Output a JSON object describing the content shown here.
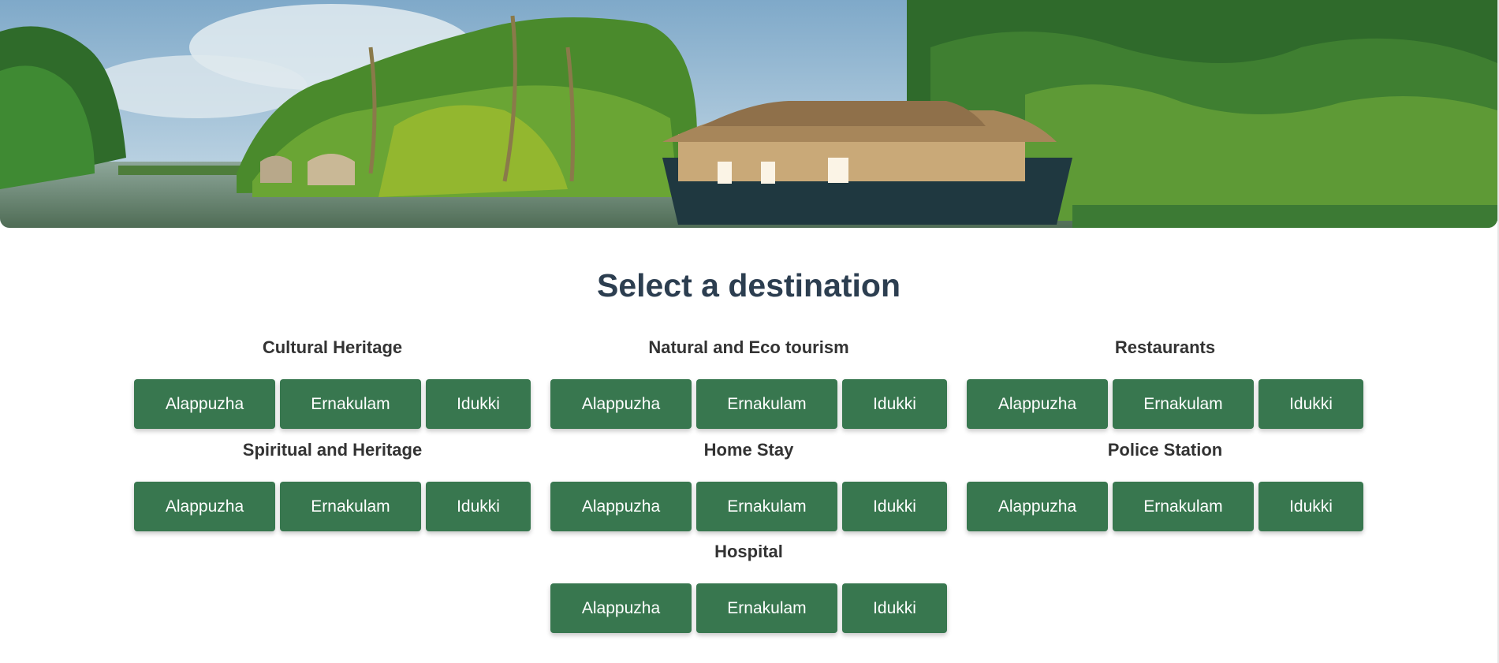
{
  "hero": {
    "alt": "Kerala backwaters houseboat"
  },
  "heading": "Select a destination",
  "sections": [
    {
      "title": "Cultural Heritage",
      "buttons": [
        "Alappuzha",
        "Ernakulam",
        "Idukki"
      ]
    },
    {
      "title": "Natural and Eco tourism",
      "buttons": [
        "Alappuzha",
        "Ernakulam",
        "Idukki"
      ]
    },
    {
      "title": "Restaurants",
      "buttons": [
        "Alappuzha",
        "Ernakulam",
        "Idukki"
      ]
    },
    {
      "title": "Spiritual and Heritage",
      "buttons": [
        "Alappuzha",
        "Ernakulam",
        "Idukki"
      ]
    },
    {
      "title": "Home Stay",
      "buttons": [
        "Alappuzha",
        "Ernakulam",
        "Idukki"
      ]
    },
    {
      "title": "Police Station",
      "buttons": [
        "Alappuzha",
        "Ernakulam",
        "Idukki"
      ]
    },
    {
      "title": "Hospital",
      "buttons": [
        "Alappuzha",
        "Ernakulam",
        "Idukki"
      ]
    }
  ],
  "colors": {
    "button_bg": "#38774f",
    "button_text": "#ffffff",
    "heading": "#2c3e50",
    "section_title": "#333333"
  }
}
